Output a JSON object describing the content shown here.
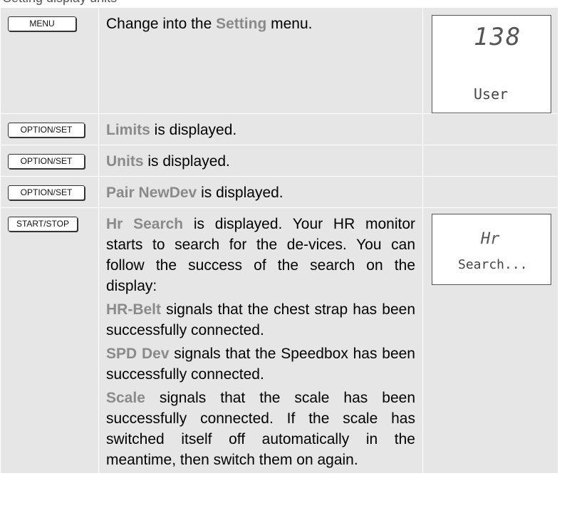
{
  "header_fragment": "Setting display units",
  "rows": [
    {
      "button": "MENU",
      "text": [
        [
          {
            "t": "Change into the "
          },
          {
            "t": "Setting",
            "hl": true
          },
          {
            "t": " menu."
          }
        ]
      ],
      "display": {
        "big": "138",
        "small": "User"
      }
    },
    {
      "button": "OPTION/SET",
      "text": [
        [
          {
            "t": "Limits",
            "hl": true
          },
          {
            "t": " is displayed."
          }
        ]
      ]
    },
    {
      "button": "OPTION/SET",
      "text": [
        [
          {
            "t": "Units",
            "hl": true
          },
          {
            "t": " is displayed."
          }
        ]
      ]
    },
    {
      "button": "OPTION/SET",
      "text": [
        [
          {
            "t": "Pair NewDev",
            "hl": true
          },
          {
            "t": " is displayed."
          }
        ]
      ]
    },
    {
      "button": "START/STOP",
      "text": [
        [
          {
            "t": "Hr Search",
            "hl": true
          },
          {
            "t": " is displayed. Your HR monitor starts to search for the de-vices. You can follow the success of the search on the display:"
          }
        ],
        [
          {
            "t": "HR-Belt",
            "hl": true
          },
          {
            "t": " signals that the chest strap has been successfully connected."
          }
        ],
        [
          {
            "t": "SPD Dev",
            "hl": true
          },
          {
            "t": " signals that the Speedbox has been successfully connected."
          }
        ],
        [
          {
            "t": "Scale",
            "hl": true
          },
          {
            "t": " signals that the scale has been successfully connected. If the scale has switched itself off automatically in the meantime, then switch them on again."
          }
        ]
      ],
      "display": {
        "big": "Hr",
        "small": "Search..."
      }
    }
  ]
}
